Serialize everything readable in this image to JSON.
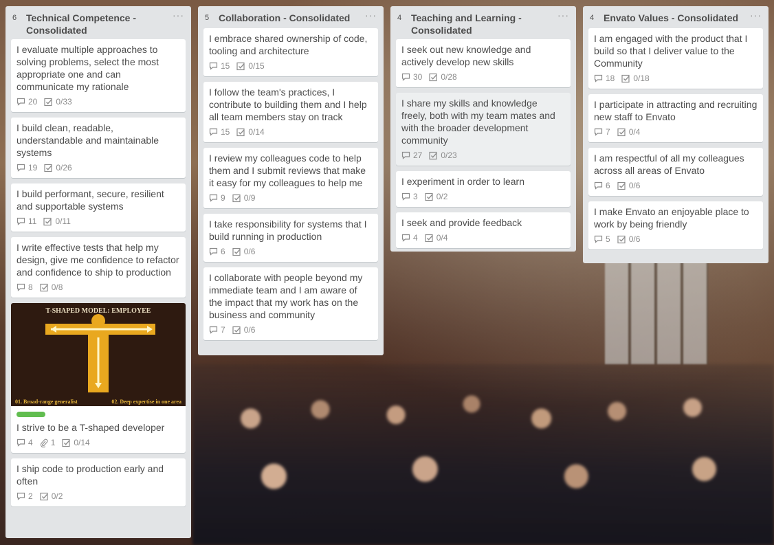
{
  "lists": [
    {
      "count": "6",
      "title": "Technical Competence - Consolidated",
      "cards": [
        {
          "title": "I evaluate multiple approaches to solving problems, select the most appropriate one and can communicate my rationale",
          "comments": "20",
          "checklist": "0/33"
        },
        {
          "title": "I build clean, readable, understandable and maintainable systems",
          "comments": "19",
          "checklist": "0/26"
        },
        {
          "title": "I build performant, secure, resilient and supportable systems",
          "comments": "11",
          "checklist": "0/11"
        },
        {
          "title": "I write effective tests that help my design, give me confidence to refactor and confidence to ship to production",
          "comments": "8",
          "checklist": "0/8"
        },
        {
          "title": "I strive to be a T-shaped developer",
          "comments": "4",
          "attachments": "1",
          "checklist": "0/14",
          "cover": {
            "heading": "T-SHAPED MODEL: EMPLOYEE",
            "foot_left": "01. Broad-range generalist",
            "foot_right": "02. Deep expertise in one area"
          }
        },
        {
          "title": "I ship code to production early and often",
          "comments": "2",
          "checklist": "0/2"
        }
      ]
    },
    {
      "count": "5",
      "title": "Collaboration - Consolidated",
      "cards": [
        {
          "title": "I embrace shared ownership of code, tooling and architecture",
          "comments": "15",
          "checklist": "0/15"
        },
        {
          "title": "I follow the team's practices, I contribute to building them and I help all team members stay on track",
          "comments": "15",
          "checklist": "0/14"
        },
        {
          "title": "I review my colleagues code to help them and I submit reviews that make it easy for my colleagues to help me",
          "comments": "9",
          "checklist": "0/9"
        },
        {
          "title": "I take responsibility for systems that I build running in production",
          "comments": "6",
          "checklist": "0/6"
        },
        {
          "title": "I collaborate with people beyond my immediate team and I am aware of the impact that my work has on the business and community",
          "comments": "7",
          "checklist": "0/6"
        }
      ]
    },
    {
      "count": "4",
      "title": "Teaching and Learning - Consolidated",
      "cards": [
        {
          "title": "I seek out new knowledge and actively develop new skills",
          "comments": "30",
          "checklist": "0/28"
        },
        {
          "title": "I share my skills and knowledge freely, both with my team mates and with the broader development community",
          "comments": "27",
          "checklist": "0/23"
        },
        {
          "title": "I experiment in order to learn",
          "comments": "3",
          "checklist": "0/2"
        },
        {
          "title": "I seek and provide feedback",
          "comments": "4",
          "checklist": "0/4"
        }
      ]
    },
    {
      "count": "4",
      "title": "Envato Values - Consolidated",
      "cards": [
        {
          "title": "I am engaged with the product that I build so that I deliver value to the Community",
          "comments": "18",
          "checklist": "0/18"
        },
        {
          "title": "I participate in attracting and recruiting new staff to Envato",
          "comments": "7",
          "checklist": "0/4"
        },
        {
          "title": "I am respectful of all my colleagues across all areas of Envato",
          "comments": "6",
          "checklist": "0/6"
        },
        {
          "title": "I make Envato an enjoyable place to work by being friendly",
          "comments": "5",
          "checklist": "0/6"
        }
      ]
    }
  ],
  "colors": {
    "list_bg": "#e2e4e6",
    "card_bg": "#ffffff",
    "label_green": "#61bd4f",
    "text": "#4d4d4d",
    "muted": "#8c8c8c"
  },
  "icons": {
    "comment": "speech-bubble-icon",
    "checklist": "checkbox-icon",
    "attachment": "paperclip-icon",
    "menu": "ellipsis-icon"
  }
}
